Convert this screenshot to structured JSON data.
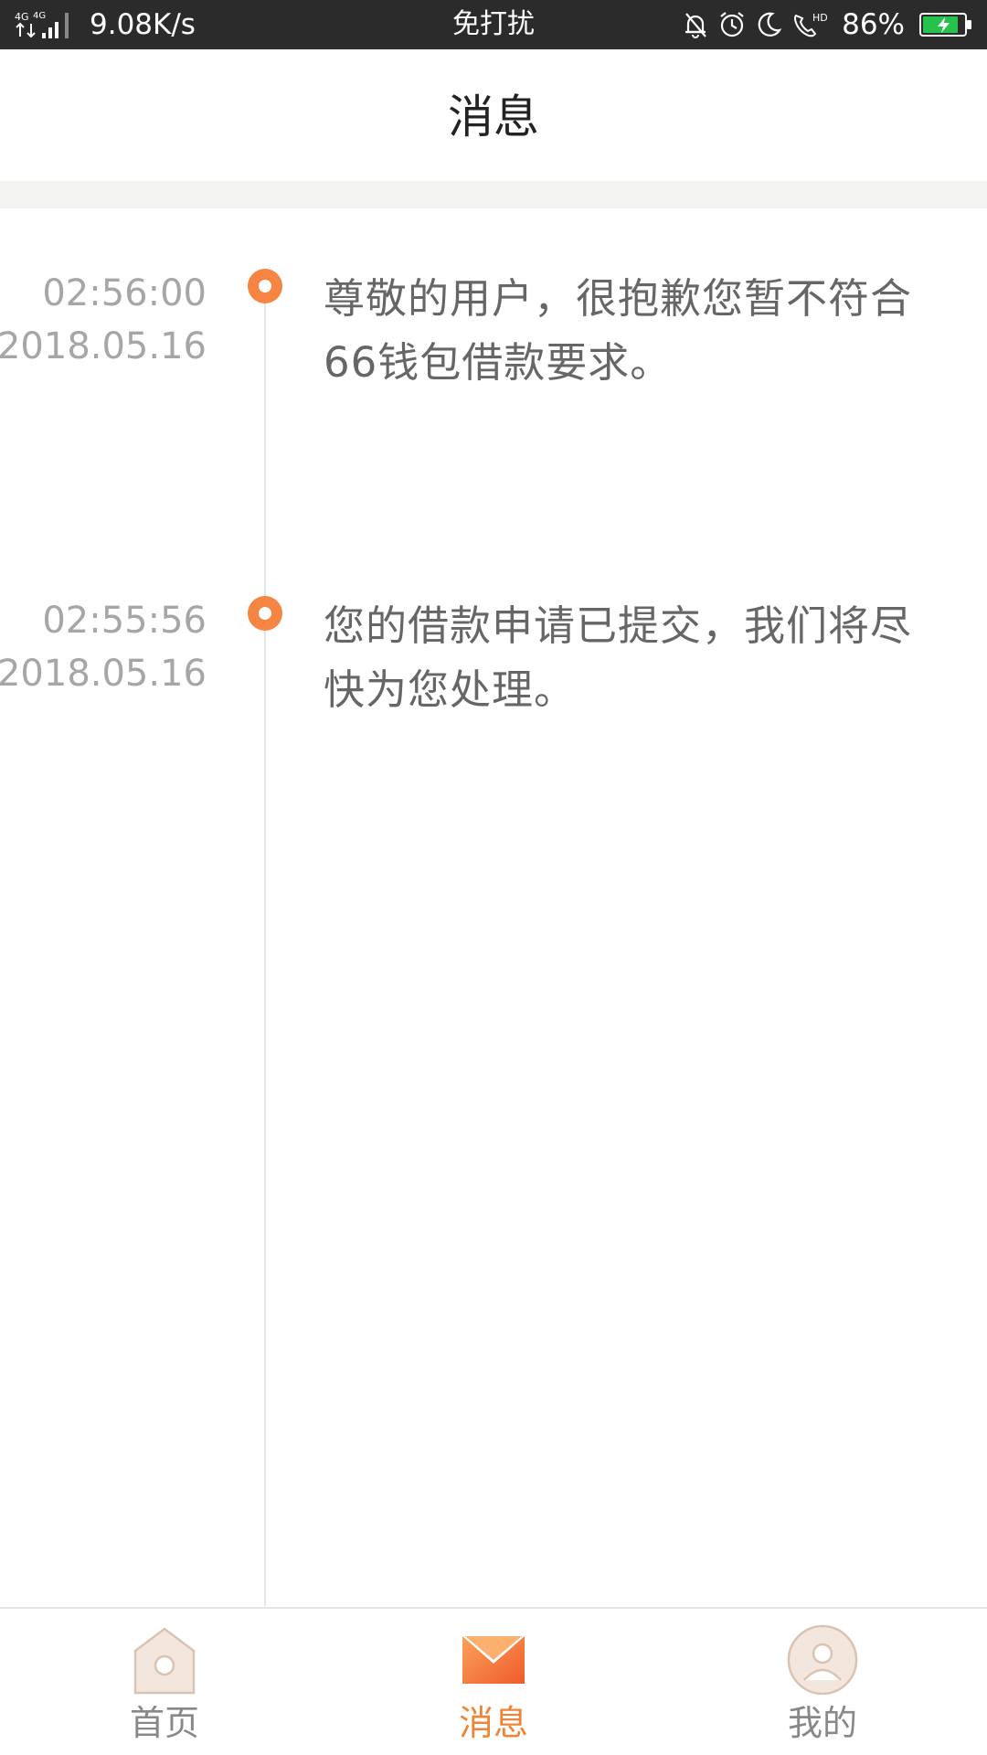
{
  "status_bar": {
    "signal": "4G 4G",
    "net_speed": "9.08K/s",
    "dnd_label": "免打扰",
    "battery_percent": "86%",
    "battery_level": 0.86,
    "icons": [
      "mute-bell-icon",
      "alarm-icon",
      "moon-icon",
      "hd-call-icon",
      "battery-charging-icon"
    ]
  },
  "header": {
    "title": "消息"
  },
  "messages": [
    {
      "time": "02:56:00",
      "date": "2018.05.16",
      "text": "尊敬的用户，很抱歉您暂不符合66钱包借款要求。"
    },
    {
      "time": "02:55:56",
      "date": "2018.05.16",
      "text": "您的借款申请已提交，我们将尽快为您处理。"
    }
  ],
  "tab_bar": {
    "tabs": [
      {
        "label": "首页",
        "icon": "home-icon",
        "active": false
      },
      {
        "label": "消息",
        "icon": "mail-icon",
        "active": true
      },
      {
        "label": "我的",
        "icon": "profile-icon",
        "active": false
      }
    ]
  },
  "colors": {
    "accent": "#f68442",
    "status_bar_bg": "#2b2b2b",
    "time_text": "#a6a6a6",
    "message_text": "#666666",
    "battery_green": "#27c24c"
  }
}
